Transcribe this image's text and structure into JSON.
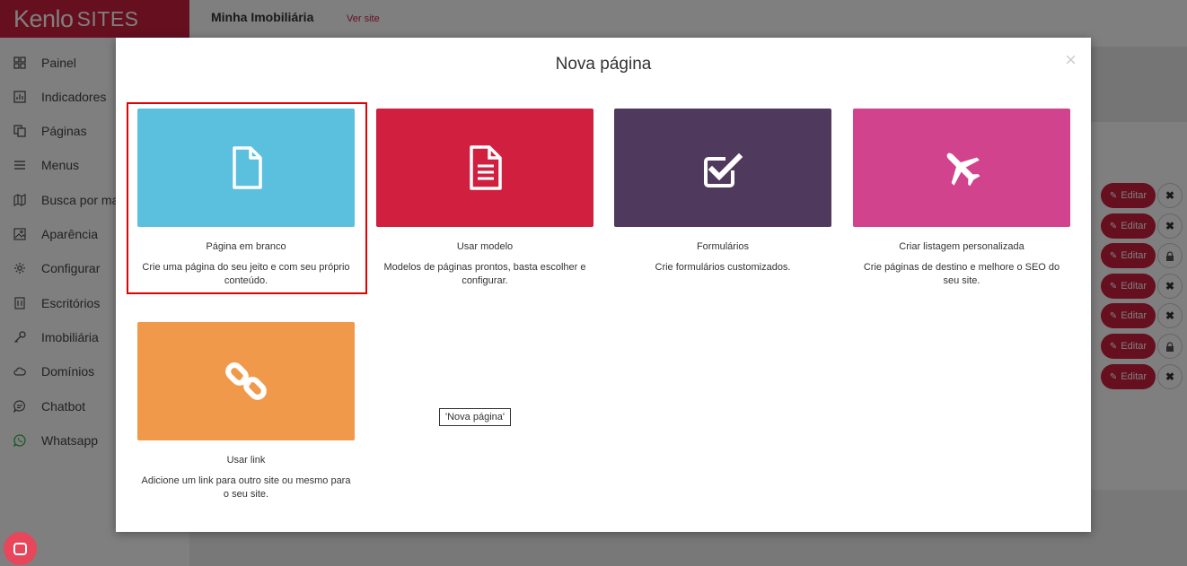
{
  "brand": {
    "logo_main": "Kenlo",
    "logo_suffix": "SITES"
  },
  "sidebar": {
    "items": [
      {
        "label": "Painel",
        "icon": "grid-icon"
      },
      {
        "label": "Indicadores",
        "icon": "chart-icon"
      },
      {
        "label": "Páginas",
        "icon": "pages-icon"
      },
      {
        "label": "Menus",
        "icon": "menu-icon"
      },
      {
        "label": "Busca por mapa",
        "icon": "map-icon"
      },
      {
        "label": "Aparência",
        "icon": "image-icon"
      },
      {
        "label": "Configurar",
        "icon": "gear-icon"
      },
      {
        "label": "Escritórios",
        "icon": "building-icon"
      },
      {
        "label": "Imobiliária",
        "icon": "key-icon"
      },
      {
        "label": "Domínios",
        "icon": "cloud-icon"
      },
      {
        "label": "Chatbot",
        "icon": "chat-icon"
      },
      {
        "label": "Whatsapp",
        "icon": "whatsapp-icon"
      }
    ]
  },
  "header": {
    "site_name": "Minha Imobiliária",
    "view_site": "Ver site"
  },
  "table": {
    "edit_label": "Editar",
    "rows": [
      {
        "action": "delete"
      },
      {
        "action": "delete"
      },
      {
        "action": "lock"
      },
      {
        "action": "delete"
      },
      {
        "action": "delete"
      },
      {
        "action": "lock"
      },
      {
        "action": "delete"
      }
    ]
  },
  "modal": {
    "title": "Nova página",
    "close_symbol": "×",
    "options": [
      {
        "title": "Página em branco",
        "description": "Crie uma página do seu jeito e com seu próprio conteúdo.",
        "color": "#5bc0de",
        "icon": "blank-page-icon"
      },
      {
        "title": "Usar modelo",
        "description": "Modelos de páginas prontos, basta escolher e configurar.",
        "color": "#d11f3f",
        "icon": "document-icon"
      },
      {
        "title": "Formulários",
        "description": "Crie formulários customizados.",
        "color": "#4f3a5e",
        "icon": "checkbox-icon"
      },
      {
        "title": "Criar listagem personalizada",
        "description": "Crie páginas de destino e melhore o SEO do seu site.",
        "color": "#d1438d",
        "icon": "plane-icon"
      },
      {
        "title": "Usar link",
        "description": "Adicione um link para outro site ou mesmo para o seu site.",
        "color": "#f0994a",
        "icon": "link-icon"
      }
    ],
    "selected_option": "Página em branco",
    "tooltip": "'Nova página'"
  },
  "colors": {
    "brand": "#cc1f3f",
    "accent_red": "#d11f3f"
  }
}
